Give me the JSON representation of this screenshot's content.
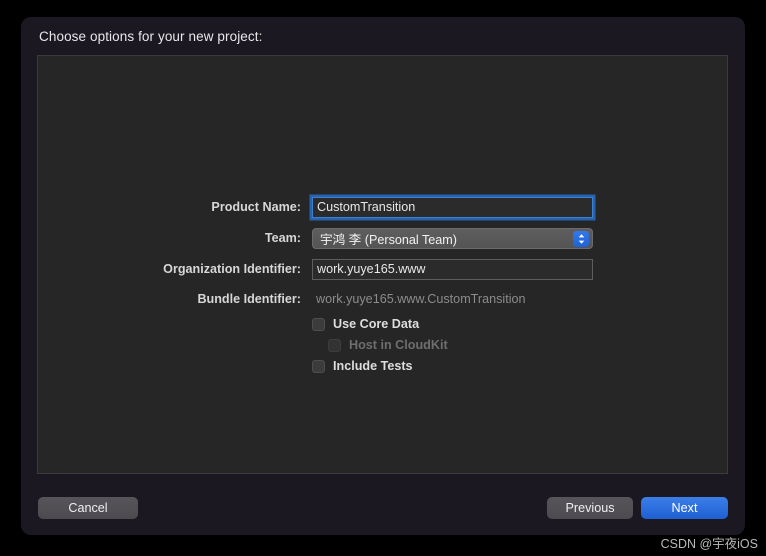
{
  "window": {
    "title": "Choose options for your new project:"
  },
  "form": {
    "fields": [
      {
        "label": "Product Name:",
        "type": "textfield",
        "value": "CustomTransition",
        "focused": true
      },
      {
        "label": "Team:",
        "type": "popup",
        "value": "宇鸿 李 (Personal Team)",
        "stepper_icon": "chevron-up-down-icon"
      },
      {
        "label": "Organization Identifier:",
        "type": "textfield",
        "value": "work.yuye165.www",
        "focused": false
      },
      {
        "label": "Bundle Identifier:",
        "type": "static",
        "value": "work.yuye165.www.CustomTransition"
      }
    ],
    "checkboxes": [
      {
        "label": "Use Core Data",
        "checked": false,
        "disabled": false,
        "indented": false
      },
      {
        "label": "Host in CloudKit",
        "checked": false,
        "disabled": true,
        "indented": true
      },
      {
        "label": "Include Tests",
        "checked": false,
        "disabled": false,
        "indented": false
      }
    ]
  },
  "footer": {
    "cancel_label": "Cancel",
    "previous_label": "Previous",
    "next_label": "Next"
  },
  "watermark": {
    "text": "CSDN @宇夜iOS"
  },
  "colors": {
    "accent_blue": "#2563d4",
    "dialog_bg": "#1c1821",
    "panel_bg": "#262626",
    "focus_ring": "#3d7fd0"
  }
}
